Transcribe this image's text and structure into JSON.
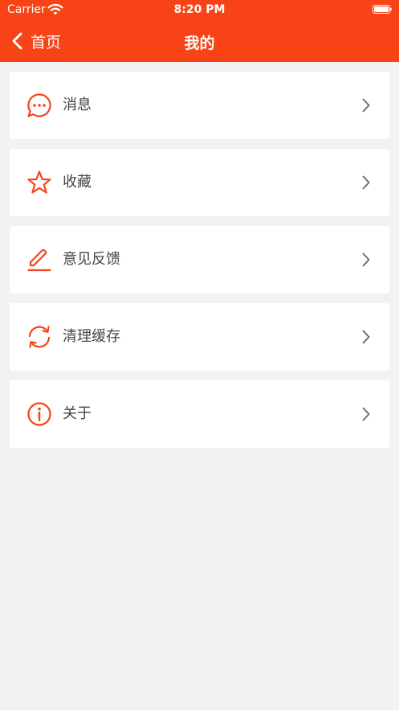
{
  "status_bar": {
    "carrier": "Carrier",
    "time": "8:20 PM"
  },
  "nav": {
    "back_label": "首页",
    "title": "我的"
  },
  "colors": {
    "accent": "#f84316",
    "background": "#f2f2f2",
    "card": "#ffffff",
    "label": "#444444",
    "chevron": "#666666"
  },
  "menu": {
    "items": [
      {
        "label": "消息",
        "icon": "message-icon"
      },
      {
        "label": "收藏",
        "icon": "star-icon"
      },
      {
        "label": "意见反馈",
        "icon": "pencil-icon"
      },
      {
        "label": "清理缓存",
        "icon": "refresh-icon"
      },
      {
        "label": "关于",
        "icon": "info-icon"
      }
    ]
  }
}
